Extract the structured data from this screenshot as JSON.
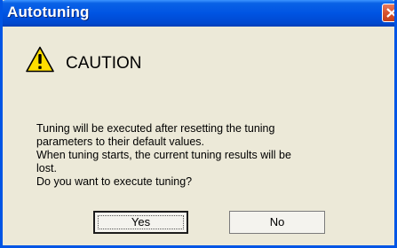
{
  "window": {
    "title": "Autotuning"
  },
  "titlebar": {
    "close_icon": "close-icon"
  },
  "header": {
    "icon": "warning-icon",
    "caution_label": "CAUTION"
  },
  "message": {
    "lines": [
      "Tuning will be executed after resetting the tuning",
      "parameters to their default values.",
      "When tuning starts, the current tuning results will be",
      "lost.",
      "Do you want to execute tuning?"
    ]
  },
  "buttons": {
    "yes_label": "Yes",
    "no_label": "No"
  },
  "colors": {
    "titlebar": "#0054e3",
    "dialog_background": "#ece9d8",
    "warning_yellow": "#ffde00"
  }
}
